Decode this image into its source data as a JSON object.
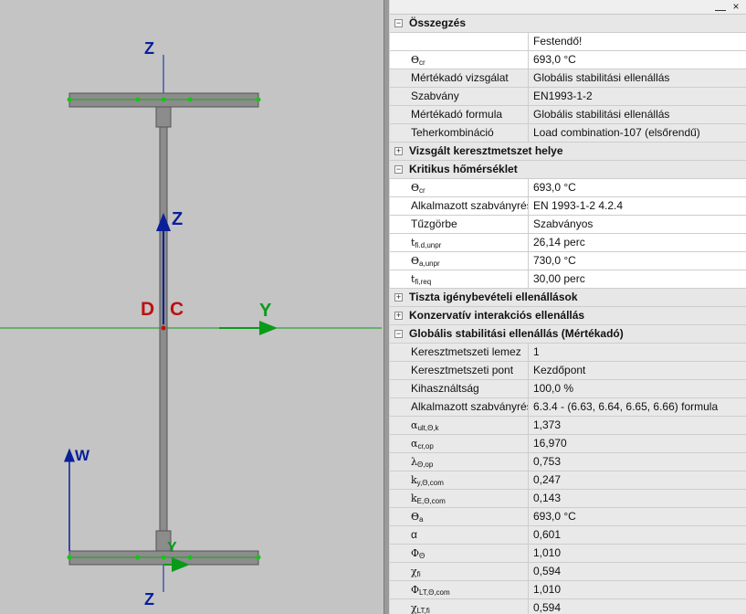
{
  "drawing": {
    "axis_labels": {
      "z_top": "Z",
      "z_bottom": "Z",
      "z_local": "Z",
      "y_main": "Y",
      "y_local": "Y",
      "w": "W",
      "d": "D",
      "c": "C"
    },
    "colors": {
      "axis_blue": "#0a1f9a",
      "axis_green": "#0a9a1a",
      "label_red": "#c01010",
      "section_fill": "#8c8c8c",
      "node_green": "#19c21c"
    }
  },
  "panel": {
    "close_label": "×",
    "groups": [
      {
        "title": "Összegzés",
        "expanded": true,
        "rows": [
          {
            "name": "",
            "value": "Festendő!",
            "highlight": true
          },
          {
            "name": "Θcr",
            "value": "693,0 °C",
            "highlight": true
          },
          {
            "name": "Mértékadó vizsgálat",
            "value": "Globális stabilitási ellenállás",
            "highlight": false
          },
          {
            "name": "Szabvány",
            "value": "EN1993-1-2",
            "highlight": false
          },
          {
            "name": "Mértékadó formula",
            "value": "Globális stabilitási ellenállás",
            "highlight": false
          },
          {
            "name": "Teherkombináció",
            "value": "Load combination-107 (elsőrendű)",
            "highlight": false
          }
        ]
      },
      {
        "title": "Vizsgált keresztmetszet helye",
        "expanded": false,
        "rows": []
      },
      {
        "title": "Kritikus hőmérséklet",
        "expanded": true,
        "rows": [
          {
            "name": "Θcr",
            "value": "693,0 °C",
            "highlight": true
          },
          {
            "name": "Alkalmazott szabványrész",
            "value": "EN 1993-1-2 4.2.4",
            "highlight": true
          },
          {
            "name": "Tűzgörbe",
            "value": "Szabványos",
            "highlight": true
          },
          {
            "name": "tfi.d,unpr",
            "value": "26,14 perc",
            "highlight": true
          },
          {
            "name": "Θa,unpr",
            "value": "730,0 °C",
            "highlight": true
          },
          {
            "name": "tfi,req",
            "value": "30,00 perc",
            "highlight": true
          }
        ]
      },
      {
        "title": "Tiszta igénybevételi ellenállások",
        "expanded": false,
        "rows": []
      },
      {
        "title": "Konzervatív interakciós ellenállás",
        "expanded": false,
        "rows": []
      },
      {
        "title": "Globális stabilitási ellenállás (Mértékadó)",
        "expanded": true,
        "rows": [
          {
            "name": "Keresztmetszeti lemez",
            "value": "1",
            "highlight": false
          },
          {
            "name": "Keresztmetszeti pont",
            "value": "Kezdőpont",
            "highlight": false
          },
          {
            "name": "Kihasználtság",
            "value": "100,0 %",
            "highlight": false
          },
          {
            "name": "Alkalmazott szabványrész",
            "value": "6.3.4 - (6.63, 6.64, 6.65, 6.66) formula",
            "highlight": false
          },
          {
            "name": "αult,Θ,k",
            "value": "1,373",
            "highlight": false
          },
          {
            "name": "αcr,op",
            "value": "16,970",
            "highlight": false
          },
          {
            "name": "λΘ,op",
            "value": "0,753",
            "highlight": false
          },
          {
            "name": "ky,Θ,com",
            "value": "0,247",
            "highlight": false
          },
          {
            "name": "kE,Θ,com",
            "value": "0,143",
            "highlight": false
          },
          {
            "name": "Θa",
            "value": "693,0 °C",
            "highlight": false
          },
          {
            "name": "α",
            "value": "0,601",
            "highlight": false
          },
          {
            "name": "ΦΘ",
            "value": "1,010",
            "highlight": false
          },
          {
            "name": "χfi",
            "value": "0,594",
            "highlight": false
          },
          {
            "name": "ΦLT,Θ,com",
            "value": "1,010",
            "highlight": false
          },
          {
            "name": "χLT,fi",
            "value": "0,594",
            "highlight": false
          }
        ]
      }
    ]
  }
}
